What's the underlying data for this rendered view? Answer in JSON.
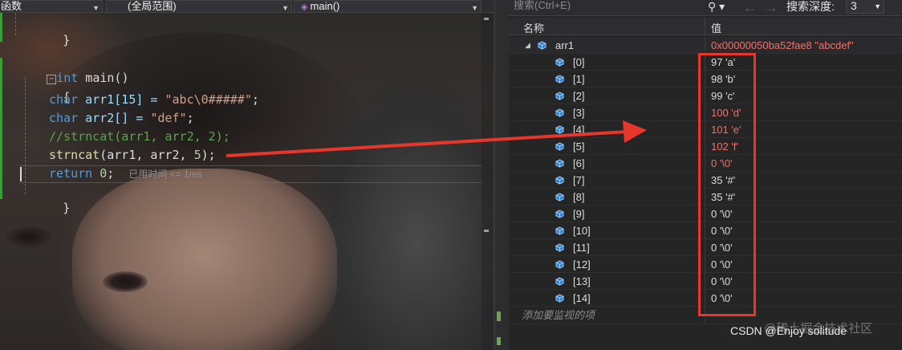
{
  "editor": {
    "toolbar": {
      "scope_combo": "函数",
      "range_combo": "(全局范围)",
      "func_combo": "main()"
    },
    "code": {
      "close_brace_top": "}",
      "main_sig": {
        "kw": "int",
        "name": " main()"
      },
      "open_brace": "{",
      "line1": {
        "kw": "char",
        "decl": " arr1[15] = ",
        "str": "\"abc\\0#####\"",
        "end": ";"
      },
      "line2": {
        "kw": "char",
        "decl": " arr2[] = ",
        "str": "\"def\"",
        "end": ";"
      },
      "line3": "//strncat(arr1, arr2, 2);",
      "line4": {
        "fn": "strncat",
        "args": "(arr1, arr2, ",
        "num": "5",
        "end": ");"
      },
      "line5": {
        "kw": "return",
        "num": " 0",
        "end": ";",
        "timing": "已用时间 <= 1ms"
      },
      "close_brace": "}"
    }
  },
  "watch": {
    "search_placeholder": "搜索(Ctrl+E)",
    "search_icon": "search-icon",
    "depth_label": "搜索深度:",
    "depth_value": "3",
    "col_name": "名称",
    "col_value": "值",
    "parent": {
      "name": "arr1",
      "value": "0x00000050ba52fae8 \"abcdef\""
    },
    "items": [
      {
        "name": "[0]",
        "value": "97 'a'",
        "changed": false
      },
      {
        "name": "[1]",
        "value": "98 'b'",
        "changed": false
      },
      {
        "name": "[2]",
        "value": "99 'c'",
        "changed": false
      },
      {
        "name": "[3]",
        "value": "100 'd'",
        "changed": true
      },
      {
        "name": "[4]",
        "value": "101 'e'",
        "changed": true
      },
      {
        "name": "[5]",
        "value": "102 'f'",
        "changed": true
      },
      {
        "name": "[6]",
        "value": "0 '\\0'",
        "changed": true
      },
      {
        "name": "[7]",
        "value": "35 '#'",
        "changed": false
      },
      {
        "name": "[8]",
        "value": "35 '#'",
        "changed": false
      },
      {
        "name": "[9]",
        "value": "0 '\\0'",
        "changed": false
      },
      {
        "name": "[10]",
        "value": "0 '\\0'",
        "changed": false
      },
      {
        "name": "[11]",
        "value": "0 '\\0'",
        "changed": false
      },
      {
        "name": "[12]",
        "value": "0 '\\0'",
        "changed": false
      },
      {
        "name": "[13]",
        "value": "0 '\\0'",
        "changed": false
      },
      {
        "name": "[14]",
        "value": "0 '\\0'",
        "changed": false
      }
    ],
    "add_watch": "添加要监视的项"
  },
  "annotation": {
    "highlight_color": "#e8362b"
  },
  "watermark": {
    "text": "CSDN @Enjoy solitude",
    "ghost": "@稀土掘金技术社区"
  }
}
